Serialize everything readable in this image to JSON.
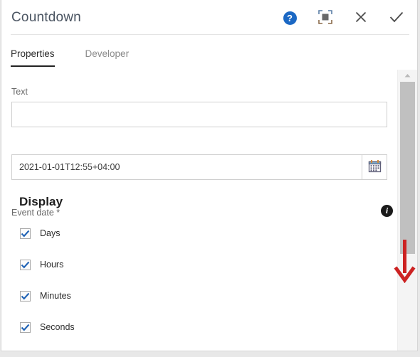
{
  "dialog": {
    "title": "Countdown",
    "actions": [
      {
        "name": "help-button",
        "icon": "help-icon",
        "glyph": "?"
      },
      {
        "name": "fullscreen-button",
        "icon": "fullscreen-icon",
        "glyph": ""
      },
      {
        "name": "close-button",
        "icon": "close-icon",
        "glyph": "✕"
      },
      {
        "name": "confirm-button",
        "icon": "check-icon",
        "glyph": "✓"
      }
    ]
  },
  "tabs": [
    {
      "label": "Properties",
      "active": true
    },
    {
      "label": "Developer",
      "active": false
    }
  ],
  "form": {
    "text": {
      "label": "Text",
      "value": "",
      "placeholder": ""
    },
    "event_date": {
      "label": "Event date *",
      "value": "2021-01-01T12:55+04:00",
      "placeholder": "",
      "info_icon": "info-icon",
      "picker_icon": "calendar-icon"
    },
    "display": {
      "title": "Display",
      "options": [
        {
          "label": "Days",
          "checked": true
        },
        {
          "label": "Hours",
          "checked": true
        },
        {
          "label": "Minutes",
          "checked": true
        },
        {
          "label": "Seconds",
          "checked": true
        }
      ]
    }
  },
  "scrollbar": {
    "up_arrow_icon": "chevron-up-icon",
    "thumb_label": "vertical-scroll-thumb"
  },
  "annotation": {
    "arrow_color": "#cc2222",
    "direction": "down"
  },
  "colors": {
    "accent_blue": "#1b68c4",
    "checkbox_check": "#1f62b5",
    "title_text": "#4b5562",
    "annotation_red": "#cc2222"
  }
}
